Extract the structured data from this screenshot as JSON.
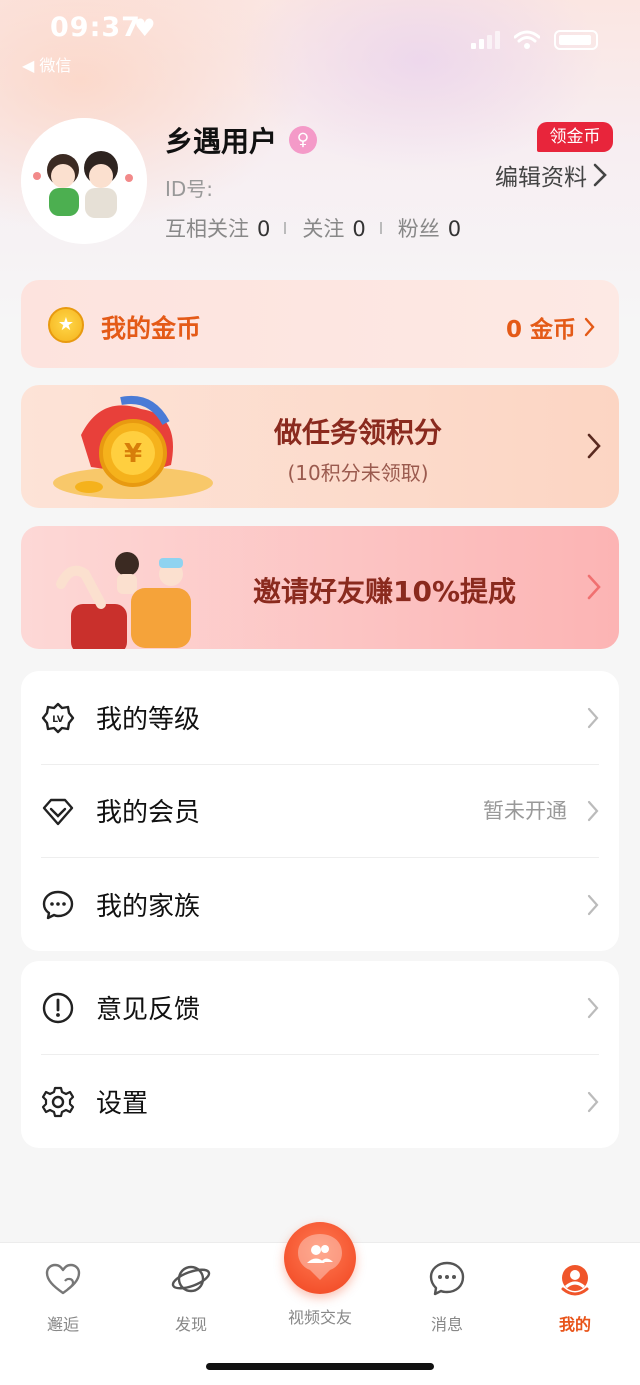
{
  "status_bar": {
    "time": "09:37",
    "back_label": "◀ 微信"
  },
  "profile": {
    "username": "乡遇用户",
    "id_label": "ID号:",
    "stats": [
      {
        "label": "互相关注",
        "value": "0"
      },
      {
        "label": "关注",
        "value": "0"
      },
      {
        "label": "粉丝",
        "value": "0"
      }
    ],
    "coin_badge": "领金币",
    "edit_label": "编辑资料"
  },
  "coins": {
    "title": "我的金币",
    "amount": "0 金币"
  },
  "task": {
    "title": "做任务领积分",
    "subtitle": "(10积分未领取)"
  },
  "invite": {
    "title": "邀请好友赚10%提成"
  },
  "menu_group_1": [
    {
      "label": "我的等级",
      "value": ""
    },
    {
      "label": "我的会员",
      "value": "暂未开通"
    },
    {
      "label": "我的家族",
      "value": ""
    }
  ],
  "menu_group_2": [
    {
      "label": "意见反馈"
    },
    {
      "label": "设置"
    }
  ],
  "tabs": [
    {
      "label": "邂逅",
      "icon": "heart-icon"
    },
    {
      "label": "发现",
      "icon": "planet-icon"
    },
    {
      "label": "视频交友",
      "icon": "video-friends-icon"
    },
    {
      "label": "消息",
      "icon": "message-icon"
    },
    {
      "label": "我的",
      "icon": "profile-icon"
    }
  ],
  "colors": {
    "accent": "#e8541a",
    "badge": "#e8253b",
    "coin_text": "#e45a17"
  }
}
